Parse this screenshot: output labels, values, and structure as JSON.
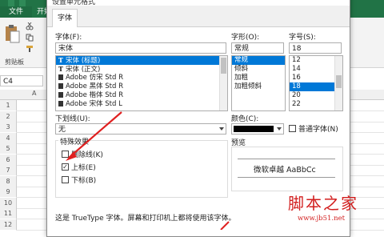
{
  "excel": {
    "file_tab": "文件",
    "start_tab": "开始",
    "clipboard_label": "剪贴板",
    "name_box": "C4",
    "col_a": "A",
    "rows": [
      "1",
      "2",
      "3",
      "4",
      "5",
      "6",
      "7",
      "8",
      "9",
      "10",
      "11",
      "12"
    ]
  },
  "dialog": {
    "title": "设置单元格式",
    "tab_font": "字体",
    "font_label": "字体(F):",
    "font_value": "宋体",
    "font_list": [
      {
        "icon": "truetype",
        "name": "宋体 (标题)",
        "selected": true
      },
      {
        "icon": "truetype",
        "name": "宋体 (正文)",
        "selected": false
      },
      {
        "icon": "opentype",
        "name": "Adobe 仿宋 Std R",
        "selected": false
      },
      {
        "icon": "opentype",
        "name": "Adobe 黑体 Std R",
        "selected": false
      },
      {
        "icon": "opentype",
        "name": "Adobe 楷体 Std R",
        "selected": false
      },
      {
        "icon": "opentype",
        "name": "Adobe 宋体 Std L",
        "selected": false
      }
    ],
    "style_label": "字形(O):",
    "style_value": "常规",
    "style_list": [
      {
        "name": "常规",
        "selected": true
      },
      {
        "name": "倾斜",
        "selected": false
      },
      {
        "name": "加粗",
        "selected": false
      },
      {
        "name": "加粗倾斜",
        "selected": false
      }
    ],
    "size_label": "字号(S):",
    "size_value": "18",
    "size_list": [
      {
        "name": "12",
        "selected": false
      },
      {
        "name": "14",
        "selected": false
      },
      {
        "name": "16",
        "selected": false
      },
      {
        "name": "18",
        "selected": true
      },
      {
        "name": "20",
        "selected": false
      },
      {
        "name": "22",
        "selected": false
      }
    ],
    "underline_label": "下划线(U):",
    "underline_value": "无",
    "color_label": "颜色(C):",
    "normal_font_label": "普通字体(N)",
    "effects_label": "特殊效果",
    "strike_label": "删除线(K)",
    "super_label": "上标(E)",
    "sub_label": "下标(B)",
    "preview_label": "预览",
    "preview_text": "微软卓越  AaBbCc",
    "footer_text": "这是 TrueType 字体。屏幕和打印机上都将使用该字体。",
    "strike_checked": false,
    "super_checked": true,
    "sub_checked": false
  },
  "watermark": {
    "text": "脚本之家",
    "url": "www.jb51.net"
  }
}
